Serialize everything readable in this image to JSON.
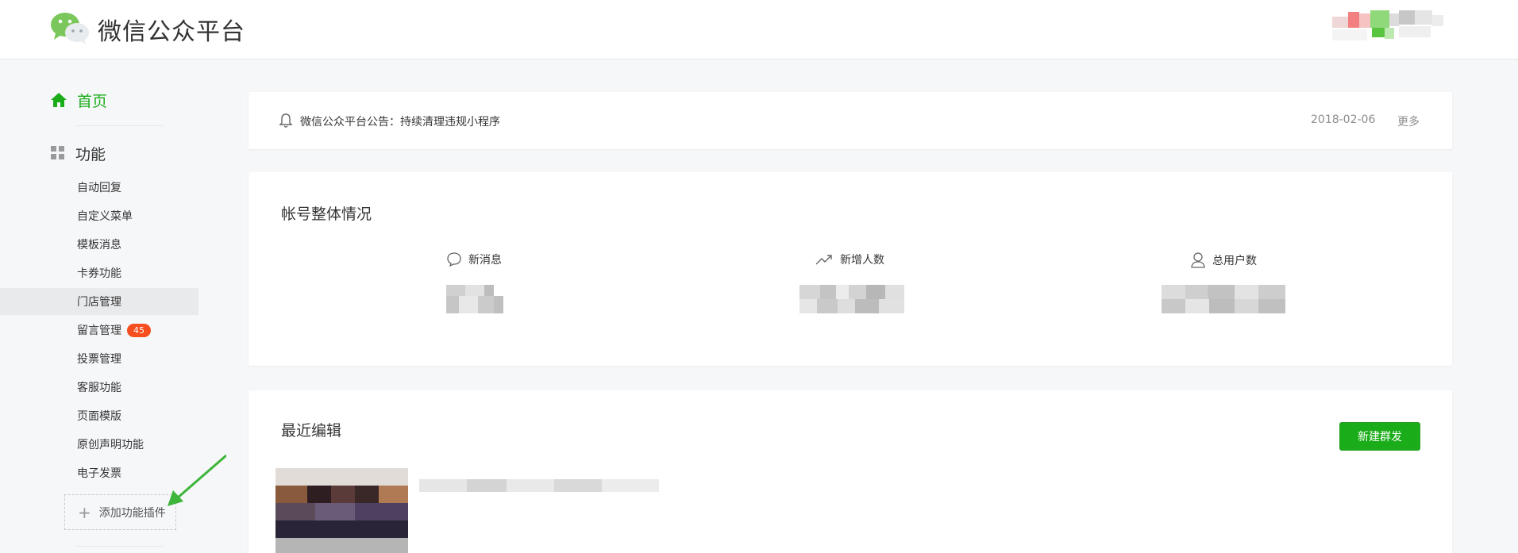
{
  "header": {
    "brand": "微信公众平台",
    "logo_icon": "wechat-logo-icon"
  },
  "sidebar": {
    "home": {
      "label": "首页",
      "icon": "home-icon"
    },
    "functions": {
      "label": "功能",
      "icon": "grid-icon"
    },
    "items": [
      {
        "label": "自动回复"
      },
      {
        "label": "自定义菜单"
      },
      {
        "label": "模板消息"
      },
      {
        "label": "卡券功能"
      },
      {
        "label": "门店管理",
        "active": true
      },
      {
        "label": "留言管理",
        "badge": "45"
      },
      {
        "label": "投票管理"
      },
      {
        "label": "客服功能"
      },
      {
        "label": "页面模版"
      },
      {
        "label": "原创声明功能"
      },
      {
        "label": "电子发票"
      }
    ],
    "add_plugin": "添加功能插件"
  },
  "notice": {
    "icon": "bell-icon",
    "text": "微信公众平台公告：持续清理违规小程序",
    "date": "2018-02-06",
    "more": "更多"
  },
  "overview": {
    "title": "帐号整体情况",
    "stats": [
      {
        "label": "新消息",
        "icon": "chat-bubble-icon"
      },
      {
        "label": "新增人数",
        "icon": "trend-up-icon"
      },
      {
        "label": "总用户数",
        "icon": "user-icon"
      }
    ]
  },
  "recent": {
    "title": "最近编辑",
    "new_button": "新建群发"
  },
  "colors": {
    "accent": "#1aad19",
    "badge": "#f64e1e",
    "background": "#f6f7f9"
  }
}
